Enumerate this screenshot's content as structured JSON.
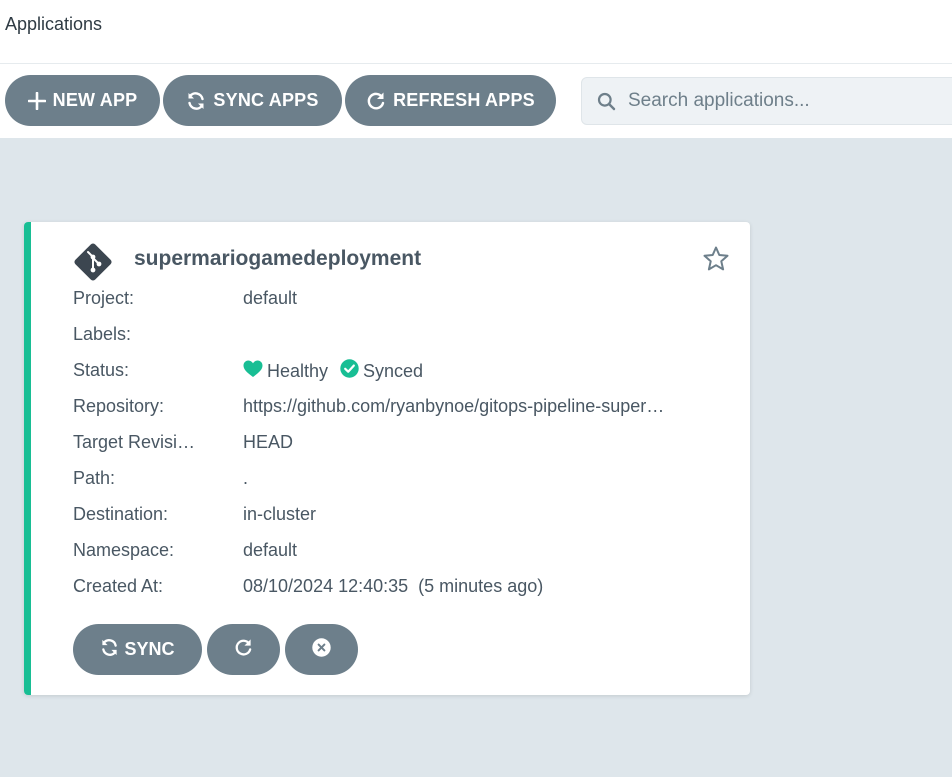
{
  "header": {
    "title": "Applications"
  },
  "toolbar": {
    "new_app_label": "NEW APP",
    "sync_apps_label": "SYNC APPS",
    "refresh_apps_label": "REFRESH APPS"
  },
  "search": {
    "placeholder": "Search applications...",
    "value": ""
  },
  "app": {
    "name": "supermariogamedeployment",
    "status_color": "#18be94",
    "favorite": false,
    "fields": {
      "project_label": "Project:",
      "project_value": "default",
      "labels_label": "Labels:",
      "labels_value": "",
      "status_label": "Status:",
      "health_text": "Healthy",
      "sync_text": "Synced",
      "repository_label": "Repository:",
      "repository_value": "https://github.com/ryanbynoe/gitops-pipeline-super…",
      "target_revision_label": "Target Revisi…",
      "target_revision_value": "HEAD",
      "path_label": "Path:",
      "path_value": ".",
      "destination_label": "Destination:",
      "destination_value": "in-cluster",
      "namespace_label": "Namespace:",
      "namespace_value": "default",
      "created_at_label": "Created At:",
      "created_at_value": "08/10/2024 12:40:35  (5 minutes ago)"
    },
    "actions": {
      "sync_label": "SYNC"
    }
  },
  "colors": {
    "button_bg": "#6d7f8b",
    "healthy": "#18be94",
    "synced": "#18be94",
    "background": "#dee6eb"
  }
}
